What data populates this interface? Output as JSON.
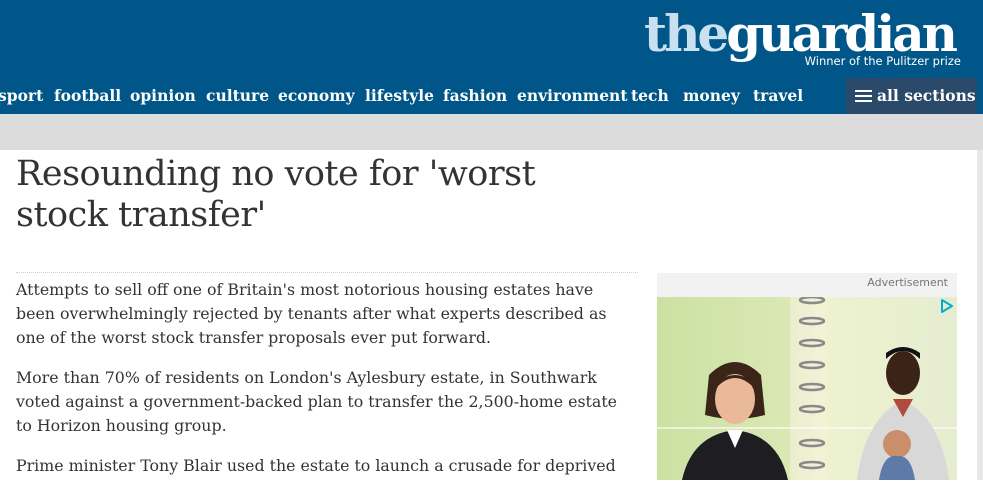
{
  "site": {
    "logo_the": "the",
    "logo_guardian": "guardian",
    "tagline": "Winner of the Pulitzer prize",
    "brand_color": "#005689"
  },
  "nav": {
    "items": [
      "sport",
      "football",
      "opinion",
      "culture",
      "economy",
      "lifestyle",
      "fashion",
      "environment",
      "tech",
      "money",
      "travel"
    ],
    "all_sections_label": "all sections",
    "all_sections_icon": "menu-icon"
  },
  "article": {
    "headline": "Resounding no vote for 'worst stock transfer'",
    "paragraphs": [
      "Attempts to sell off one of Britain's most notorious housing estates have been overwhelmingly rejected by tenants after what experts described as one of the worst stock transfer proposals ever put forward.",
      "More than 70% of residents on London's Aylesbury estate, in Southwark voted against a government-backed plan to transfer the 2,500-home estate to Horizon housing group.",
      "Prime minister Tony Blair used the estate to launch a crusade for deprived"
    ]
  },
  "advert": {
    "label": "Advertisement",
    "choices_icon": "adchoices-icon"
  }
}
